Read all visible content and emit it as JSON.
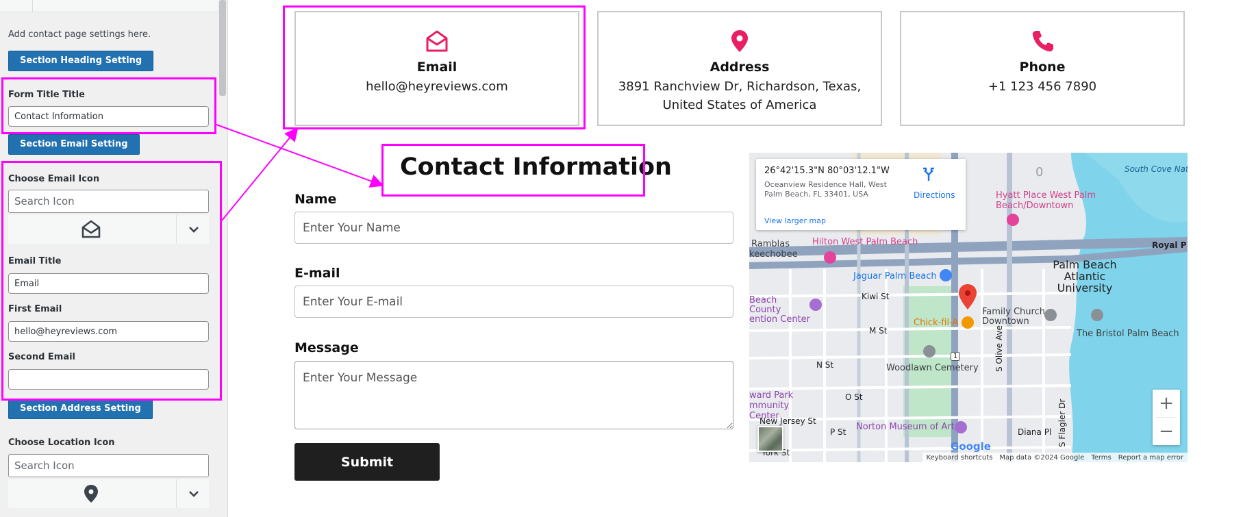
{
  "sidebar": {
    "description": "Add contact page settings here.",
    "heading_section_label": "Section Heading Setting",
    "form_title_label": "Form Title Title",
    "form_title_value": "Contact Information",
    "email_section_label": "Section Email Setting",
    "choose_email_icon_label": "Choose Email Icon",
    "search_icon_placeholder": "Search Icon",
    "email_title_label": "Email Title",
    "email_title_value": "Email",
    "first_email_label": "First Email",
    "first_email_value": "hello@heyreviews.com",
    "second_email_label": "Second Email",
    "second_email_value": "",
    "address_section_label": "Section Address Setting",
    "choose_location_icon_label": "Choose Location Icon",
    "search_icon_placeholder_2": "Search Icon"
  },
  "cards": {
    "email": {
      "icon": "envelope-open-icon",
      "title": "Email",
      "value": "hello@heyreviews.com"
    },
    "address": {
      "icon": "map-pin-icon",
      "title": "Address",
      "value": "3891 Ranchview Dr, Richardson, Texas, United States of America"
    },
    "phone": {
      "icon": "phone-icon",
      "title": "Phone",
      "value": "+1 123 456 7890"
    }
  },
  "form": {
    "title": "Contact Information",
    "name_label": "Name",
    "name_placeholder": "Enter Your Name",
    "email_label": "E-mail",
    "email_placeholder": "Enter Your E-mail",
    "message_label": "Message",
    "message_placeholder": "Enter Your Message",
    "submit_label": "Submit"
  },
  "map": {
    "coords": "26°42'15.3\"N 80°03'12.1\"W",
    "address": "Oceanview Residence Hall, West Palm Beach, FL 33401, USA",
    "larger_map": "View larger map",
    "directions": "Directions",
    "labels": {
      "south_cove": "South Cove Natural Area",
      "hyatt": "Hyatt Place West Palm Beach/Downtown",
      "hilton": "Hilton West Palm Beach",
      "ramblas": "Ramblas",
      "keechobee": "keechobee",
      "royal": "Royal P",
      "jaguar": "Jaguar Palm Beach",
      "university": "Palm Beach Atlantic University",
      "beach_county": "Beach County ention Center",
      "kiwi": "Kiwi St",
      "family_church": "Family Church Downtown",
      "chick_fil_a": "Chick-fil-A",
      "bristol": "The Bristol Palm Beach",
      "m_st": "M St",
      "n_st": "N St",
      "woodlawn": "Woodlawn Cemetery",
      "olive": "S Olive Ave",
      "o_st": "O St",
      "ward_park": "ward Park mmunity Center",
      "new_jersey": "New Jersey St",
      "p_st": "P St",
      "norton": "Norton Museum of Art",
      "diana": "Diana Pl",
      "flagler": "S Flagler Dr",
      "york": "York St",
      "route": "1",
      "zero": "0"
    },
    "zoom_in": "+",
    "zoom_out": "−",
    "google": "Google",
    "footer": {
      "shortcuts": "Keyboard shortcuts",
      "data": "Map data ©2024 Google",
      "terms": "Terms",
      "report": "Report a map error"
    }
  },
  "colors": {
    "accent_pink": "#e91e63",
    "highlight": "#ff00ff",
    "wp_button": "#2271b1",
    "submit_bg": "#1f1f1f"
  }
}
